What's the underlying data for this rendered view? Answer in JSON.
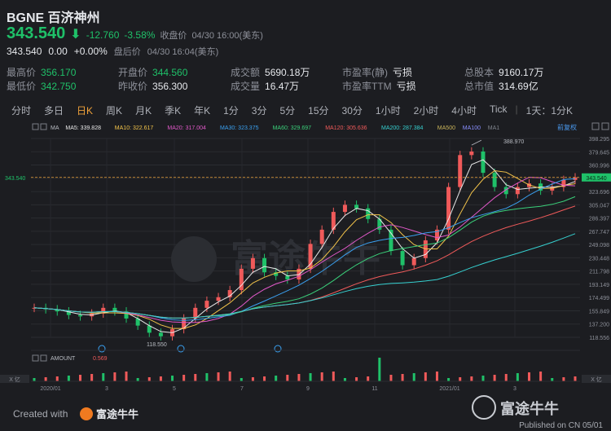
{
  "header": {
    "title": "BGNE 百济神州",
    "price": "343.540",
    "change": "-12.760",
    "change_pct": "-3.58%",
    "close_label": "收盘价",
    "close_time": "04/30 16:00(美东)",
    "after_price": "343.540",
    "after_change": "0.00",
    "after_pct": "+0.00%",
    "after_label": "盘后价",
    "after_time": "04/30 16:04(美东)"
  },
  "stats": [
    {
      "label": "最高价",
      "value": "356.170",
      "color": "#1fc169"
    },
    {
      "label": "开盘价",
      "value": "344.560",
      "color": "#1fc169"
    },
    {
      "label": "成交额",
      "value": "5690.18万",
      "color": "#e6e8ec"
    },
    {
      "label": "市盈率(静)",
      "value": "亏损",
      "color": "#e6e8ec"
    },
    {
      "label": "总股本",
      "value": "9160.17万",
      "color": "#e6e8ec"
    },
    {
      "label": "最低价",
      "value": "342.750",
      "color": "#1fc169"
    },
    {
      "label": "昨收价",
      "value": "356.300",
      "color": "#e6e8ec"
    },
    {
      "label": "成交量",
      "value": "16.47万",
      "color": "#e6e8ec"
    },
    {
      "label": "市盈率TTM",
      "value": "亏损",
      "color": "#e6e8ec"
    },
    {
      "label": "总市值",
      "value": "314.69亿",
      "color": "#e6e8ec"
    }
  ],
  "tabs": [
    "分时",
    "多日",
    "日K",
    "周K",
    "月K",
    "季K",
    "年K",
    "1分",
    "3分",
    "5分",
    "15分",
    "30分",
    "1小时",
    "2小时",
    "4小时",
    "Tick",
    "1天：1分K"
  ],
  "active_tab": "日K",
  "ma_legend": [
    {
      "label": "MA",
      "color": "#b9bcc3"
    },
    {
      "label": "MA5: 339.828",
      "color": "#e8e8e8"
    },
    {
      "label": "MA10: 322.617",
      "color": "#f2c34a"
    },
    {
      "label": "MA20: 317.004",
      "color": "#e058c8"
    },
    {
      "label": "MA30: 323.375",
      "color": "#3aa0f0"
    },
    {
      "label": "MA60: 329.697",
      "color": "#3ad07a"
    },
    {
      "label": "MA120: 305.636",
      "color": "#f05a5a"
    },
    {
      "label": "MA200: 287.384",
      "color": "#36d0d0"
    },
    {
      "label": "MA500",
      "color": "#c9b45a"
    },
    {
      "label": "MA100",
      "color": "#8a8fff"
    },
    {
      "label": "MA1",
      "color": "#7f838c"
    }
  ],
  "fuquan": "前复权",
  "y_ticks": [
    "398.295",
    "379.645",
    "360.996",
    "342.346",
    "323.696",
    "305.047",
    "286.397",
    "267.747",
    "249.098",
    "230.448",
    "211.798",
    "193.149",
    "174.499",
    "155.849",
    "137.200",
    "118.556"
  ],
  "current_price_label": "343.540",
  "x_ticks": [
    "2020/01",
    "3",
    "5",
    "7",
    "9",
    "11",
    "2021/01",
    "3"
  ],
  "annotations": {
    "high": "388.970",
    "low": "118.550"
  },
  "amount_label": "AMOUNT",
  "amount_value": "0.569",
  "x_zoom": "X 亿",
  "watermark": "富途牛牛",
  "footer": {
    "created_with": "Created with",
    "brand": "富途牛牛",
    "brand_big": "富途牛牛",
    "published": "Published on CN 05/01"
  },
  "chart_data": {
    "type": "line",
    "ylim": [
      118.55,
      398.295
    ],
    "series": [
      {
        "values": [
          160,
          158,
          155,
          150,
          148,
          152,
          160,
          155,
          145,
          135,
          125,
          120,
          130,
          145,
          160,
          170,
          175,
          185,
          215,
          230,
          210,
          205,
          200,
          215,
          250,
          270,
          295,
          305,
          300,
          285,
          270,
          240,
          220,
          230,
          255,
          270,
          330,
          375,
          380,
          350,
          330,
          320,
          330,
          335,
          325,
          330,
          340,
          343.54
        ]
      }
    ]
  }
}
